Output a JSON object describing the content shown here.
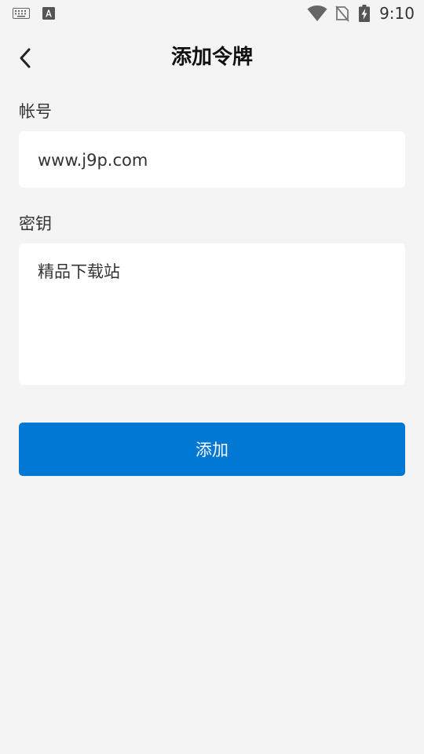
{
  "status_bar": {
    "time": "9:10",
    "icons": [
      "keyboard-icon",
      "text-a-icon",
      "wifi-icon",
      "no-sim-icon",
      "battery-charging-icon"
    ]
  },
  "header": {
    "back_icon": "chevron-left-icon",
    "title": "添加令牌"
  },
  "form": {
    "account": {
      "label": "帐号",
      "value": "www.j9p.com"
    },
    "secret": {
      "label": "密钥",
      "value": "精品下载站"
    },
    "submit_label": "添加"
  },
  "colors": {
    "background": "#f4f4f4",
    "field_background": "#ffffff",
    "primary_button": "#0078d4",
    "button_text": "#ffffff"
  }
}
